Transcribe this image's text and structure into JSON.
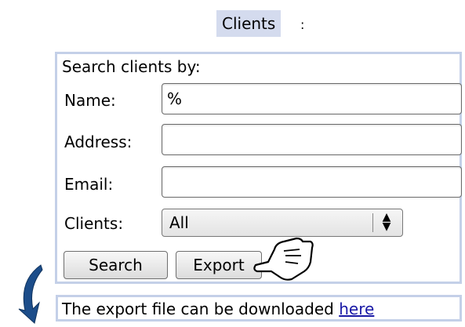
{
  "header": {
    "title": "Clients",
    "colon": ":"
  },
  "search_form": {
    "heading": "Search clients by:",
    "fields": {
      "name": {
        "label": "Name:",
        "value": "%"
      },
      "address": {
        "label": "Address:",
        "value": ""
      },
      "email": {
        "label": "Email:",
        "value": ""
      },
      "clients": {
        "label": "Clients:",
        "selected": "All",
        "control_icon": "updown-arrows-icon"
      }
    },
    "buttons": {
      "search": "Search",
      "export": "Export"
    }
  },
  "result": {
    "text": "The export file can be downloaded ",
    "link_text": "here"
  },
  "annotations": {
    "arrow_icon": "curved-arrow-icon",
    "pointer_icon": "pointing-hand-icon",
    "panel_border_color": "#c4d0e8",
    "title_bg_color": "#d4dbee",
    "link_color": "#1a1aa6"
  }
}
